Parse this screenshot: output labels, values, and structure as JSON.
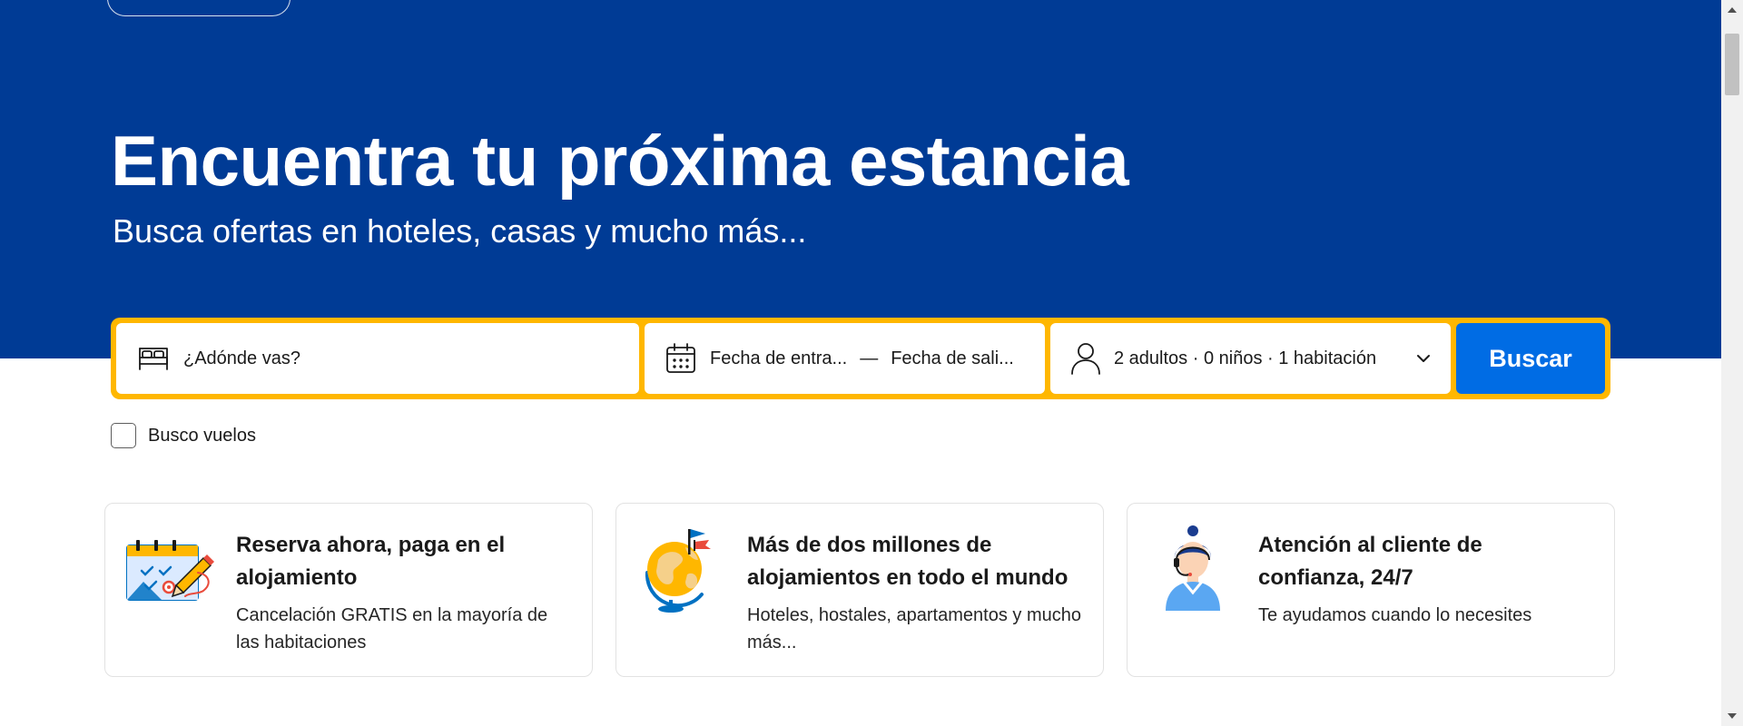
{
  "colors": {
    "hero_background": "#003b95",
    "search_border": "#ffb700",
    "search_button": "#006ce4"
  },
  "hero": {
    "title": "Encuentra tu próxima estancia",
    "subtitle": "Busca ofertas en hoteles, casas y mucho más..."
  },
  "search": {
    "destination_placeholder": "¿Adónde vas?",
    "destination_icon": "bed-icon",
    "checkin_label": "Fecha de entra...",
    "date_separator": "—",
    "checkout_label": "Fecha de sali...",
    "dates_icon": "calendar-icon",
    "guests_label": "2 adultos · 0 niños · 1 habitación",
    "guests_icon": "person-icon",
    "guests_dropdown_icon": "chevron-down-icon",
    "button_label": "Buscar"
  },
  "flights": {
    "label": "Busco vuelos",
    "checked": false
  },
  "features": [
    {
      "icon": "calendar-booking-illustration",
      "title": "Reserva ahora, paga en el alojamiento",
      "description": "Cancelación GRATIS en la mayoría de las habitaciones"
    },
    {
      "icon": "globe-illustration",
      "title": "Más de dos millones de alojamientos en todo el mundo",
      "description": "Hoteles, hostales, apartamentos y mucho más..."
    },
    {
      "icon": "customer-service-illustration",
      "title": "Atención al cliente de confianza, 24/7",
      "description": "Te ayudamos cuando lo necesites"
    }
  ]
}
